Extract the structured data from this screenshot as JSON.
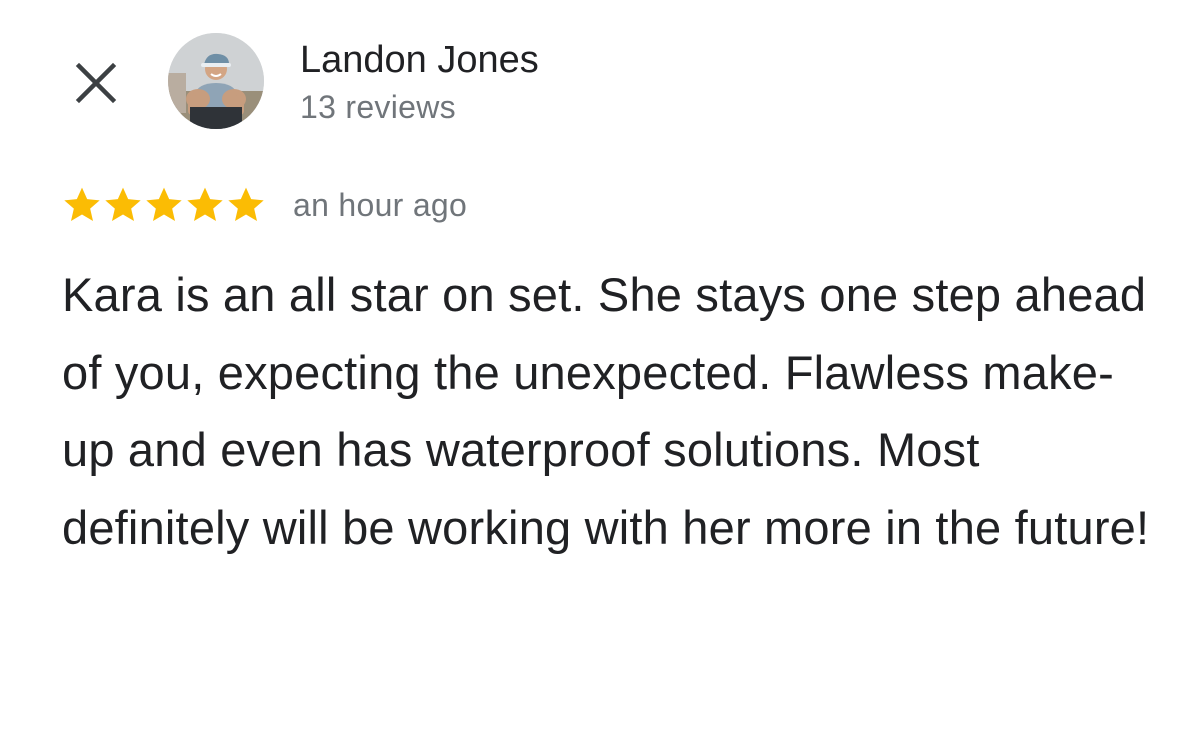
{
  "reviewer": {
    "name": "Landon Jones",
    "review_count": "13 reviews",
    "avatar_icon": "person-avatar-photo"
  },
  "controls": {
    "close_icon": "close-icon"
  },
  "review": {
    "rating": 5,
    "rating_max": 5,
    "time": "an hour ago",
    "text": "Kara is an all star on set. She stays one step ahead of you, expecting the unexpected. Flawless make-up and even has waterproof solutions. Most definitely will be working with her more in the future!"
  },
  "colors": {
    "star": "#FBBC04",
    "primary_text": "#202124",
    "secondary_text": "#70757A",
    "background": "#FFFFFF"
  }
}
